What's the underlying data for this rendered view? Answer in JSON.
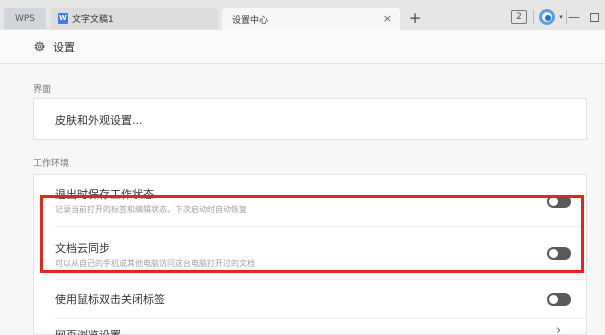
{
  "tabs": {
    "wps": "WPS",
    "doc": "文字文稿1",
    "settings": "设置中心",
    "close": "×",
    "add": "+"
  },
  "window": {
    "badge": "2",
    "caret": "▾",
    "minimize": "—"
  },
  "header": {
    "title": "设置"
  },
  "sections": [
    {
      "label": "界面"
    },
    {
      "label": "工作环境"
    }
  ],
  "appearance": {
    "title": "皮肤和外观设置..."
  },
  "work": {
    "save_state": {
      "title": "退出时保存工作状态",
      "desc": "记录当前打开的标签和编辑状态，下次启动时自动恢复",
      "enabled": false
    },
    "cloud_sync": {
      "title": "文档云同步",
      "desc": "可以从自己的手机或其他电脑访问这台电脑打开过的文档",
      "enabled": false
    },
    "dblclick_close": {
      "title": "使用鼠标双击关闭标签",
      "enabled": false
    },
    "page_browse": {
      "title": "网页浏览设置"
    }
  }
}
